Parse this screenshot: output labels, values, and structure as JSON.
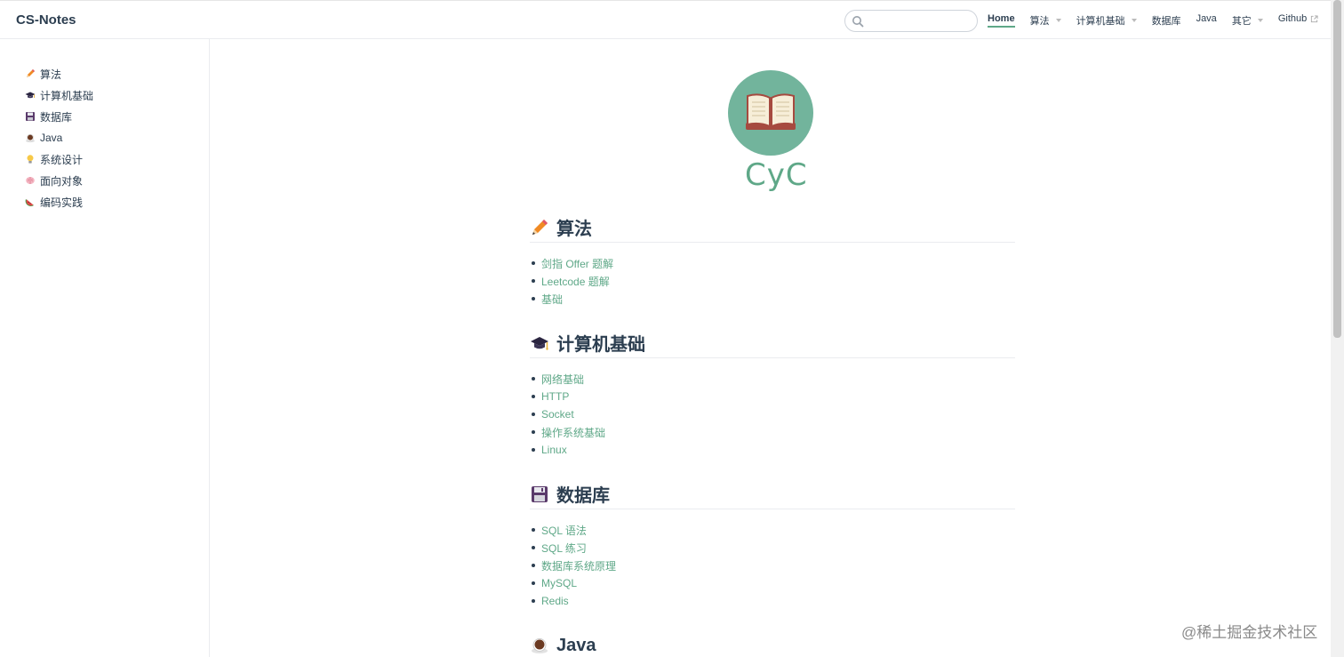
{
  "navbar": {
    "site_name": "CS-Notes",
    "search": {
      "value": "",
      "placeholder": ""
    },
    "links": [
      {
        "label": "Home",
        "active": true,
        "dropdown": false
      },
      {
        "label": "算法",
        "active": false,
        "dropdown": true
      },
      {
        "label": "计算机基础",
        "active": false,
        "dropdown": true
      },
      {
        "label": "数据库",
        "active": false,
        "dropdown": false
      },
      {
        "label": "Java",
        "active": false,
        "dropdown": false
      },
      {
        "label": "其它",
        "active": false,
        "dropdown": true
      },
      {
        "label": "Github",
        "active": false,
        "dropdown": false,
        "external": true
      }
    ]
  },
  "sidebar": {
    "items": [
      {
        "label": "算法",
        "icon": "pencil-icon"
      },
      {
        "label": "计算机基础",
        "icon": "graduation-cap-icon"
      },
      {
        "label": "数据库",
        "icon": "floppy-disk-icon"
      },
      {
        "label": "Java",
        "icon": "coffee-icon"
      },
      {
        "label": "系统设计",
        "icon": "lightbulb-icon"
      },
      {
        "label": "面向对象",
        "icon": "brain-icon"
      },
      {
        "label": "编码实践",
        "icon": "watermelon-icon"
      }
    ]
  },
  "hero": {
    "logo_text": "CyC",
    "icon": "open-book-icon"
  },
  "sections": [
    {
      "title": "算法",
      "icon": "pencil-icon",
      "links": [
        "剑指 Offer 题解",
        "Leetcode 题解",
        "基础"
      ]
    },
    {
      "title": "计算机基础",
      "icon": "graduation-cap-icon",
      "links": [
        "网络基础",
        "HTTP",
        "Socket",
        "操作系统基础",
        "Linux"
      ]
    },
    {
      "title": "数据库",
      "icon": "floppy-disk-icon",
      "links": [
        "SQL 语法",
        "SQL 练习",
        "数据库系统原理",
        "MySQL",
        "Redis"
      ]
    },
    {
      "title": "Java",
      "icon": "coffee-icon",
      "links": []
    }
  ],
  "watermark": "@稀土掘金技术社区",
  "colors": {
    "accent": "#5fa888",
    "hero_bg": "#72b49c",
    "text": "#2c3e50"
  }
}
